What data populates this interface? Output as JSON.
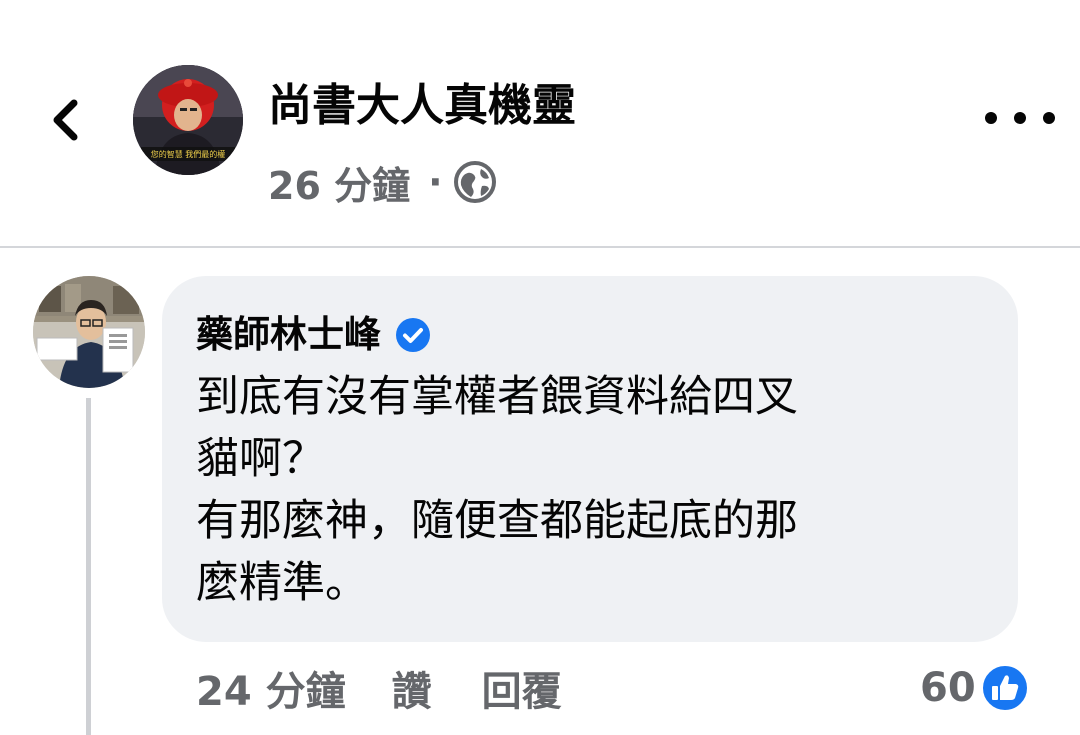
{
  "header": {
    "page_name": "尚書大人真機靈",
    "time": "26 分鐘",
    "separator": "·",
    "avatar_caption": "您的智慧 我們最的權",
    "icons": {
      "back": "chevron-left-icon",
      "privacy": "globe-icon",
      "more": "more-options-icon"
    }
  },
  "comment": {
    "author": "藥師林士峰",
    "verified_badge": "verified-icon",
    "text": "到底有沒有掌權者餵資料給四叉\n貓啊？\n有那麼神，隨便查都能起底的那\n麼精準。",
    "actions": {
      "time": "24 分鐘",
      "like": "讚",
      "reply": "回覆"
    },
    "reaction_count": "60",
    "reaction_icon": "like-icon"
  },
  "colors": {
    "accent": "#1877f2",
    "bubble_bg": "#eff1f4",
    "secondary_text": "#65676b",
    "text": "#050505"
  }
}
